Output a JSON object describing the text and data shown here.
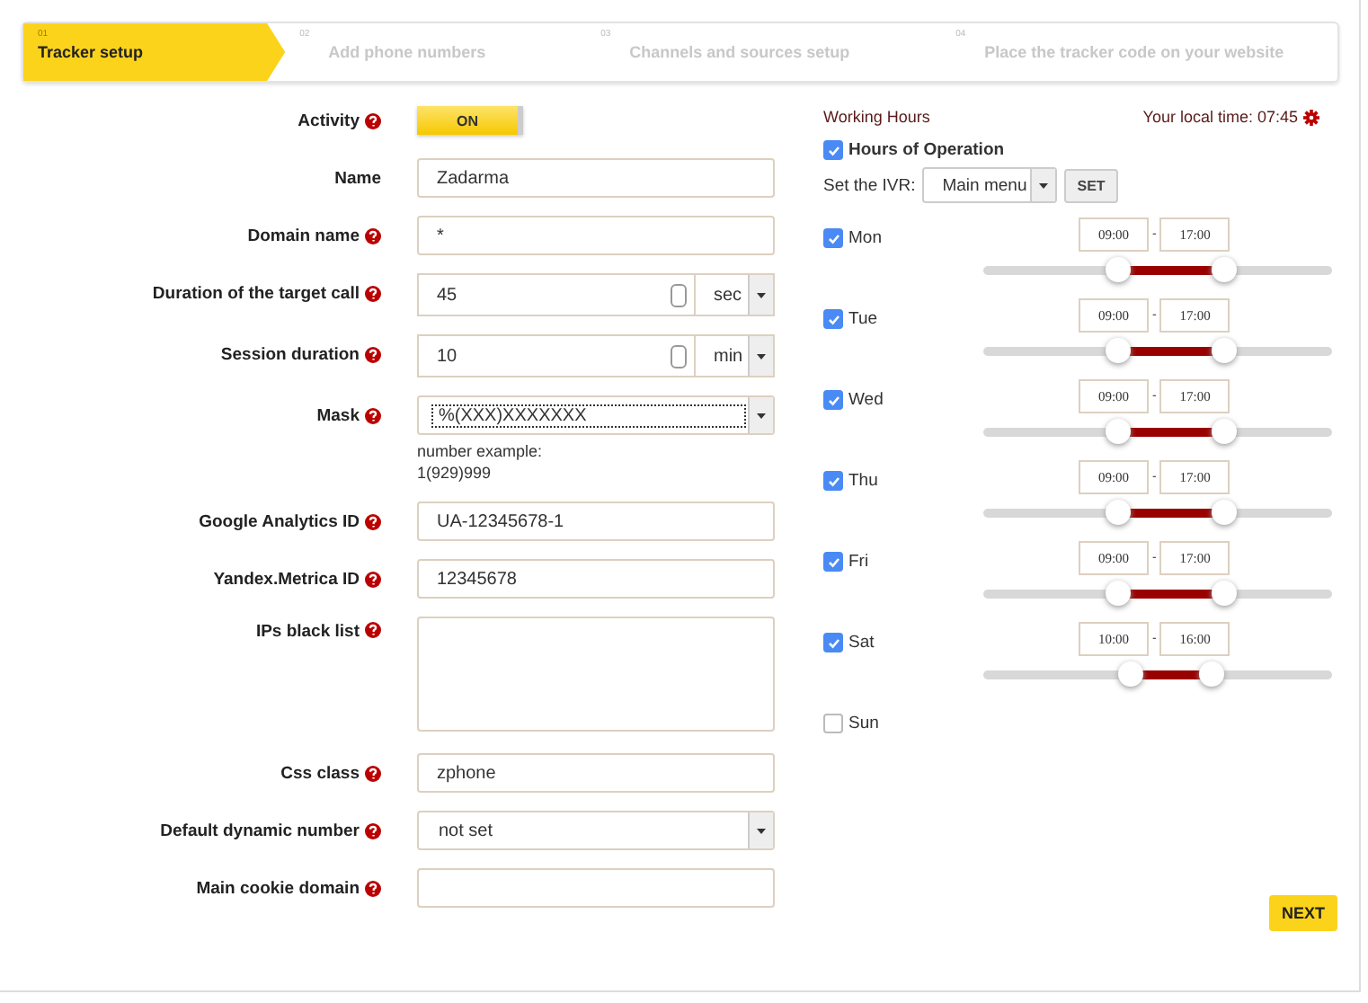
{
  "steps": [
    {
      "number": "01",
      "label": "Tracker setup",
      "selected": true
    },
    {
      "number": "02",
      "label": "Add phone numbers",
      "selected": false
    },
    {
      "number": "03",
      "label": "Channels and sources setup",
      "selected": false
    },
    {
      "number": "04",
      "label": "Place the tracker code on your website",
      "selected": false
    }
  ],
  "form": [
    {
      "kind": "toggle",
      "label": "Activity",
      "help": true,
      "text": "ON",
      "on": true
    },
    {
      "kind": "text",
      "label": "Name",
      "help": false,
      "value": "Zadarma"
    },
    {
      "kind": "text",
      "label": "Domain name",
      "help": true,
      "value": "*"
    },
    {
      "kind": "number-unit",
      "label": "Duration of the target call",
      "help": true,
      "value": "45",
      "unit": "sec"
    },
    {
      "kind": "number-unit",
      "label": "Session duration",
      "help": true,
      "value": "10",
      "unit": "min"
    },
    {
      "kind": "select",
      "label": "Mask",
      "help": true,
      "value": "%(XXX)XXXXXXX",
      "focused": true,
      "note": [
        "number example:",
        "1(929)999"
      ]
    },
    {
      "kind": "text",
      "label": "Google Analytics ID",
      "help": true,
      "value": "UA-12345678-1"
    },
    {
      "kind": "text",
      "label": "Yandex.Metrica ID",
      "help": true,
      "value": "12345678"
    },
    {
      "kind": "textarea",
      "label": "IPs black list",
      "help": true
    },
    {
      "kind": "text",
      "label": "Css class",
      "help": true,
      "value": "zphone"
    },
    {
      "kind": "select",
      "label": "Default dynamic number",
      "help": true,
      "value": "not set",
      "focused": false
    },
    {
      "kind": "text",
      "label": "Main cookie domain",
      "help": true
    }
  ],
  "working_hours": {
    "title": "Working Hours",
    "local_time": "Your local time: 07:45",
    "hours_of_operation": {
      "label": "Hours of Operation",
      "checked": true
    },
    "ivr": {
      "label": "Set the IVR:",
      "value": "Main menu",
      "button": "SET"
    },
    "days": [
      {
        "name": "Mon",
        "checked": true,
        "from": "09:00",
        "separator": "-",
        "to": "17:00",
        "range": {
          "start": {
            "level": 0.375
          },
          "end": {
            "level": 0.708
          }
        }
      },
      {
        "name": "Tue",
        "checked": true,
        "from": "09:00",
        "separator": "-",
        "to": "17:00",
        "range": {
          "start": {
            "level": 0.375
          },
          "end": {
            "level": 0.708
          }
        }
      },
      {
        "name": "Wed",
        "checked": true,
        "from": "09:00",
        "separator": "-",
        "to": "17:00",
        "range": {
          "start": {
            "level": 0.375
          },
          "end": {
            "level": 0.708
          }
        }
      },
      {
        "name": "Thu",
        "checked": true,
        "from": "09:00",
        "separator": "-",
        "to": "17:00",
        "range": {
          "start": {
            "level": 0.375
          },
          "end": {
            "level": 0.708
          }
        }
      },
      {
        "name": "Fri",
        "checked": true,
        "from": "09:00",
        "separator": "-",
        "to": "17:00",
        "range": {
          "start": {
            "level": 0.375
          },
          "end": {
            "level": 0.708
          }
        }
      },
      {
        "name": "Sat",
        "checked": true,
        "from": "10:00",
        "separator": "-",
        "to": "16:00",
        "range": {
          "start": {
            "level": 0.417
          },
          "end": {
            "level": 0.667
          }
        }
      },
      {
        "name": "Sun",
        "checked": false
      }
    ]
  },
  "next_button": "NEXT"
}
